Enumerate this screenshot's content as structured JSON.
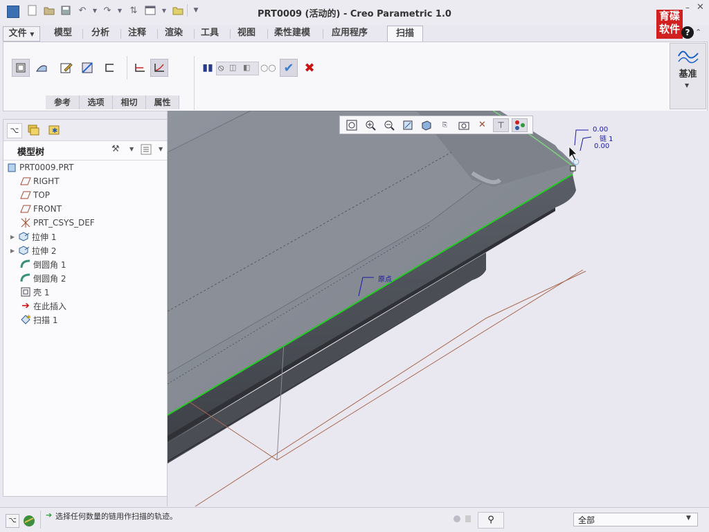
{
  "window": {
    "title": "PRT0009 (活动的) - Creo Parametric 1.0"
  },
  "logo": {
    "line1": "育碟",
    "line2": "软件"
  },
  "menu": {
    "file": "文件",
    "tabs": [
      "模型",
      "分析",
      "注释",
      "渲染",
      "工具",
      "视图",
      "柔性建模",
      "应用程序"
    ],
    "active_tab": "扫描"
  },
  "ribbon": {
    "subtabs": [
      "参考",
      "选项",
      "相切",
      "属性"
    ],
    "datum_label": "基准"
  },
  "model_tree": {
    "title": "模型树",
    "root": "PRT0009.PRT",
    "items": [
      {
        "label": "RIGHT",
        "icon": "datum-plane-icon"
      },
      {
        "label": "TOP",
        "icon": "datum-plane-icon"
      },
      {
        "label": "FRONT",
        "icon": "datum-plane-icon"
      },
      {
        "label": "PRT_CSYS_DEF",
        "icon": "csys-icon"
      },
      {
        "label": "拉伸 1",
        "icon": "extrude-icon",
        "expandable": true
      },
      {
        "label": "拉伸 2",
        "icon": "extrude-icon",
        "expandable": true
      },
      {
        "label": "倒圆角 1",
        "icon": "round-icon"
      },
      {
        "label": "倒圆角 2",
        "icon": "round-icon"
      },
      {
        "label": "壳 1",
        "icon": "shell-icon"
      },
      {
        "label": "在此插入",
        "icon": "insert-here-icon"
      },
      {
        "label": "扫描 1",
        "icon": "sweep-icon"
      }
    ]
  },
  "viewport": {
    "annotations": {
      "value_top": "0.00",
      "chain": "链 1",
      "value_bottom": "0.00",
      "origin": "原点"
    }
  },
  "status": {
    "message": "选择任何数量的链用作扫描的轨迹。",
    "filter": "全部"
  },
  "colors": {
    "edge_highlight": "#22cc22",
    "annotation": "#1a1aa8",
    "cancel": "#cc1111",
    "accept": "#3a7fd0"
  }
}
